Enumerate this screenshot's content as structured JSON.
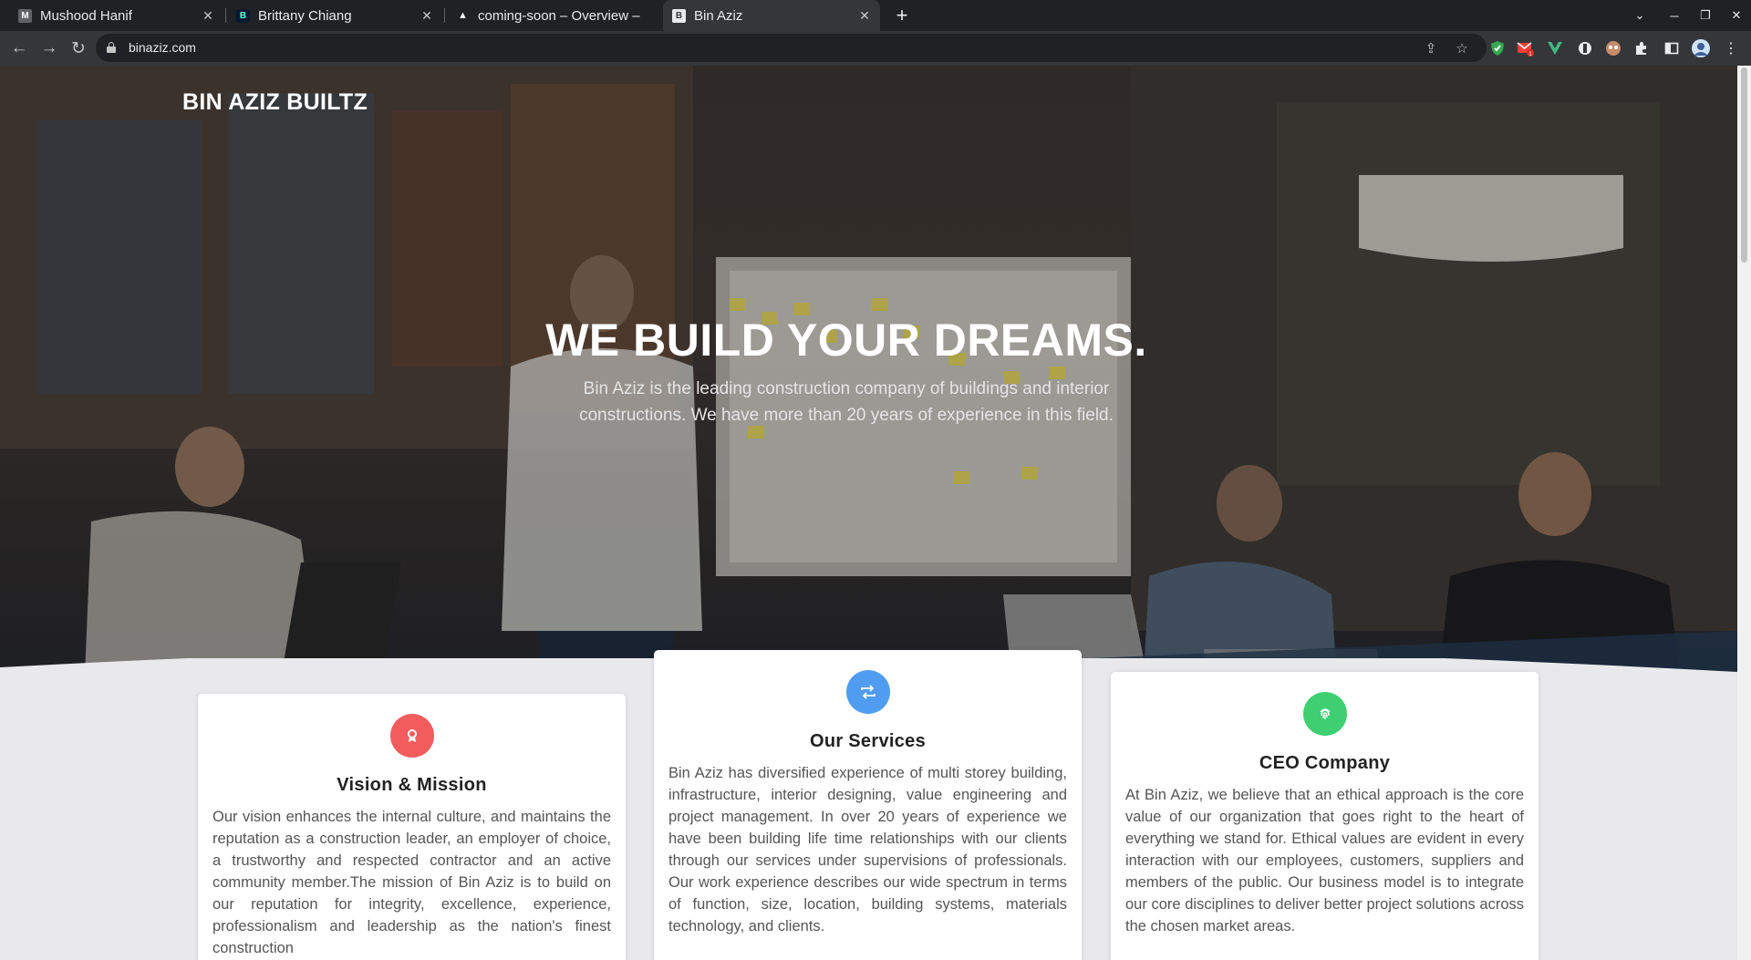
{
  "browser": {
    "tabs": [
      {
        "title": "Mushood Hanif",
        "favicon": "M",
        "active": false
      },
      {
        "title": "Brittany Chiang",
        "favicon": "B",
        "active": false
      },
      {
        "title": "coming-soon – Overview –",
        "favicon": "▲",
        "active": false
      },
      {
        "title": "Bin Aziz",
        "favicon": "B",
        "active": true
      }
    ],
    "url": "binaziz.com",
    "extension_badge": "1"
  },
  "site": {
    "brand": "BIN AZIZ BUILTZ",
    "hero": {
      "title": "WE BUILD YOUR DREAMS.",
      "subtitle": "Bin Aziz is the leading construction company of buildings and interior constructions. We have more than 20 years of experience in this field."
    },
    "cards": [
      {
        "title": "Vision & Mission",
        "icon": "award-icon",
        "color": "#f25c5c",
        "text": "Our vision enhances the internal culture, and maintains the reputation as a construction leader, an employer of choice, a trustworthy and respected contractor and an active community member.The mission of Bin Aziz is to build on our reputation for integrity, excellence, experience, professionalism and leadership as the nation's finest construction"
      },
      {
        "title": "Our Services",
        "icon": "repeat-icon",
        "color": "#4f9cf0",
        "text": "Bin Aziz has diversified experience of multi storey building, infrastructure, interior designing, value engineering and project management. In over 20 years of experience we have been building life time relationships with our clients through our services under supervisions of professionals. Our work experience describes our wide spectrum in terms of function, size, location, building systems, materials technology, and clients."
      },
      {
        "title": "CEO Company",
        "icon": "fingerprint-icon",
        "color": "#3ecf71",
        "text": "At Bin Aziz, we believe that an ethical approach is the core value of our organization that goes right to the heart of everything we stand for. Ethical values are evident in every interaction with our employees, customers, suppliers and members of the public. Our business model is to integrate our core disciplines to deliver better project solutions across the chosen market areas."
      }
    ]
  }
}
